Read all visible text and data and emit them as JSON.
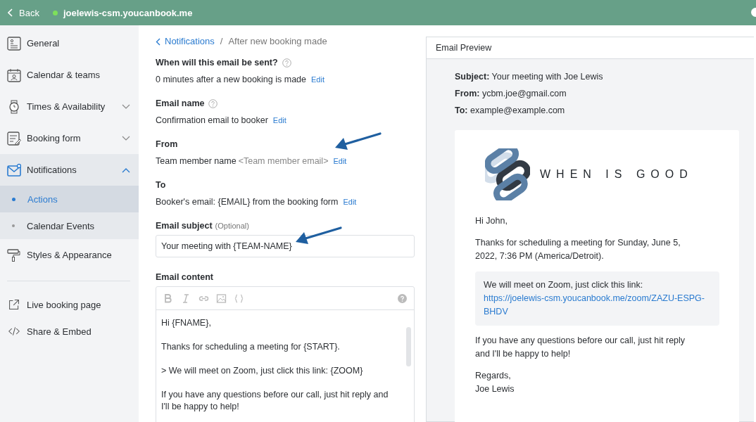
{
  "top_bar": {
    "back": "Back",
    "site": "joelewis-csm.youcanbook.me",
    "online": true
  },
  "sidebar": {
    "items": [
      {
        "kind": "general",
        "label": "General",
        "active": false
      },
      {
        "kind": "calendar",
        "label": "Calendar & teams",
        "active": false
      },
      {
        "kind": "watch",
        "label": "Times & Availability",
        "active": false,
        "expanded": false
      },
      {
        "kind": "form",
        "label": "Booking form",
        "active": false,
        "expanded": false
      },
      {
        "kind": "mail",
        "label": "Notifications",
        "active": true,
        "expanded": true,
        "children": [
          {
            "label": "Actions",
            "selected": true
          },
          {
            "label": "Calendar Events",
            "selected": false
          }
        ]
      },
      {
        "kind": "roller",
        "label": "Styles & Appearance",
        "active": false
      }
    ],
    "links": [
      {
        "kind": "external",
        "label": "Live booking page"
      },
      {
        "kind": "code",
        "label": "Share & Embed"
      }
    ]
  },
  "breadcrumb": {
    "parent": "Notifications",
    "separator": "/",
    "current": "After new booking made"
  },
  "settings": [
    {
      "label": "When will this email be sent?",
      "help": true,
      "value": "0 minutes after a new booking is made",
      "edit": "Edit"
    },
    {
      "label": "Email name",
      "help": true,
      "value": "Confirmation email to booker",
      "edit": "Edit"
    },
    {
      "label": "From",
      "help": false,
      "value": "Team member name",
      "muted_value": "<Team member email>",
      "edit": "Edit"
    },
    {
      "label": "To",
      "help": false,
      "value": "Booker's email: {EMAIL} from the booking form",
      "edit": "Edit"
    }
  ],
  "subject": {
    "label": "Email subject",
    "hint": "(Optional)",
    "value": "Your meeting with {TEAM-NAME}"
  },
  "content": {
    "label": "Email content",
    "paragraphs": [
      "Hi {FNAME},",
      "Thanks for scheduling a meeting for {START}.",
      "> We will meet on Zoom, just click this link: {ZOOM}",
      "If you have any questions before our call, just hit reply and I'll be happy to help!"
    ]
  },
  "callouts": [
    {
      "kind": "arrow"
    },
    {
      "kind": "arrow"
    }
  ],
  "preview": {
    "title": "Email Preview",
    "headers": [
      {
        "name": "Subject:",
        "value": "Your meeting with Joe Lewis"
      },
      {
        "name": "From:",
        "value": "ycbm.joe@gmail.com"
      },
      {
        "name": "To:",
        "value": "example@example.com"
      }
    ],
    "logo_text": "WHEN IS GOOD",
    "greeting": "Hi John,",
    "intro": "Thanks for scheduling a meeting for Sunday, June 5, 2022, 7:36 PM (America/Detroit).",
    "zoom_note": "We will meet on Zoom, just click this link:",
    "zoom_link": "https://joelewis-csm.youcanbook.me/zoom/ZAZU-ESPG-BHDV",
    "closing": "If you have any questions before our call, just hit reply and I'll be happy to help!",
    "signoff": [
      "Regards,",
      "Joe Lewis"
    ]
  }
}
